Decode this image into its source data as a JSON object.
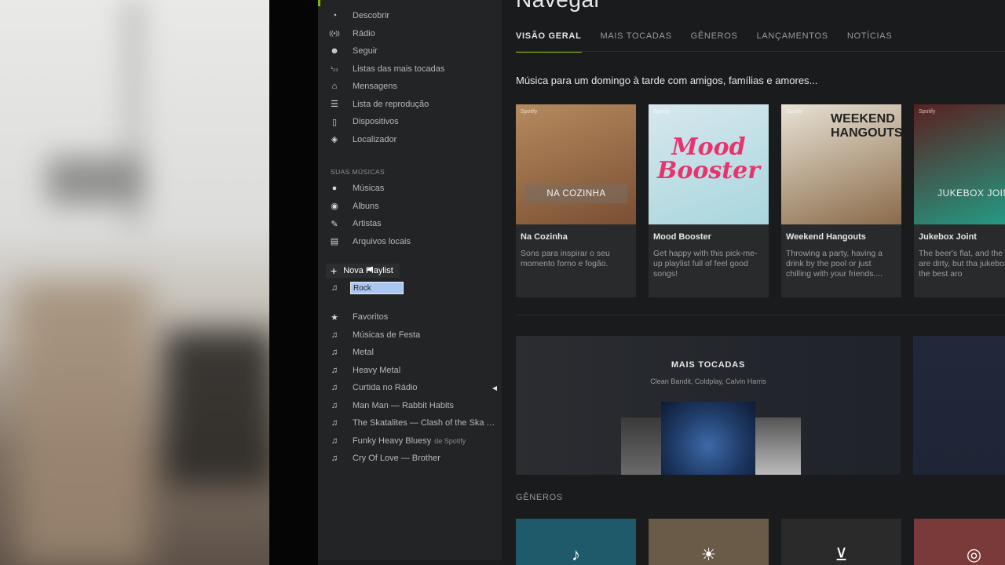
{
  "header": {
    "title": "Navegar"
  },
  "tabs": [
    {
      "label": "VISÃO GERAL",
      "active": true
    },
    {
      "label": "MAIS TOCADAS"
    },
    {
      "label": "GÊNEROS"
    },
    {
      "label": "LANÇAMENTOS"
    },
    {
      "label": "NOTÍCIAS"
    }
  ],
  "sidebar": {
    "nav": [
      {
        "label": "Descobrir",
        "icon": "compass-icon"
      },
      {
        "label": "Rádio",
        "icon": "radio-icon"
      },
      {
        "label": "Seguir",
        "icon": "follow-icon"
      },
      {
        "label": "Listas das mais tocadas",
        "icon": "charts-icon"
      },
      {
        "label": "Mensagens",
        "icon": "inbox-icon"
      },
      {
        "label": "Lista de reprodução",
        "icon": "queue-icon"
      },
      {
        "label": "Dispositivos",
        "icon": "devices-icon"
      },
      {
        "label": "Localizador",
        "icon": "cube-icon"
      }
    ],
    "your_music_title": "SUAS MÚSICAS",
    "your_music": [
      {
        "label": "Músicas",
        "icon": "songs-icon"
      },
      {
        "label": "Álbuns",
        "icon": "albums-icon"
      },
      {
        "label": "Artistas",
        "icon": "artists-icon"
      },
      {
        "label": "Arquivos locais",
        "icon": "local-files-icon"
      }
    ],
    "new_playlist": "Nova Playlist",
    "rename_value": "Rock",
    "playlists": [
      {
        "label": "Favoritos",
        "icon": "star-icon"
      },
      {
        "label": "Músicas de Festa",
        "icon": "note-icon"
      },
      {
        "label": "Metal",
        "icon": "note-icon"
      },
      {
        "label": "Heavy Metal",
        "icon": "note-icon"
      },
      {
        "label": "Curtida no Rádio",
        "icon": "note-icon",
        "playing": true
      },
      {
        "label": "Man Man — Rabbit Habits",
        "icon": "note-icon"
      },
      {
        "label": "The Skatalites — Clash of the Ska Ti...",
        "icon": "note-icon"
      },
      {
        "label": "Funky Heavy Bluesy",
        "by": "de Spotify",
        "icon": "note-icon"
      },
      {
        "label": "Cry Of Love — Brother",
        "icon": "note-icon"
      }
    ]
  },
  "main": {
    "headline": "Música para um domingo à tarde com amigos, famílias e amores...",
    "cards": [
      {
        "name": "Na Cozinha",
        "overlay": "NA COZINHA",
        "desc": "Sons para inspirar o seu momento forno e fogão.",
        "colors": [
          "#b58a5e",
          "#7a4f33"
        ]
      },
      {
        "name": "Mood Booster",
        "overlay": "Mood Booster",
        "desc": "Get happy with this pick-me-up playlist full of feel good songs!",
        "colors": [
          "#d7e7ee",
          "#a8d6dd"
        ]
      },
      {
        "name": "Weekend Hangouts",
        "overlay": "WEEKEND HANGOUTS",
        "desc": "Throwing a party, having a drink by the pool or just chilling with your friends....",
        "colors": [
          "#e8e2d4",
          "#8a6b4a"
        ]
      },
      {
        "name": "Jukebox Joint",
        "overlay": "JUKEBOX JOIN",
        "desc": "The beer's flat, and the floors are dirty, but tha jukebox is the best aro",
        "colors": [
          "#5a2020",
          "#20a28a"
        ]
      }
    ],
    "spotify_tag": "Spotify",
    "feature": {
      "title": "MAIS TOCADAS",
      "subtitle": "Clean Bandit, Coldplay, Calvin Harris"
    },
    "genres_title": "GÊNEROS",
    "genres": [
      {
        "icon": "guitar-icon",
        "color": "#1e5a6a"
      },
      {
        "icon": "sun-icon",
        "color": "#6a5a48"
      },
      {
        "icon": "drinks-icon",
        "color": "#2a2a2a"
      },
      {
        "icon": "microphone-icon",
        "color": "#7a3a3a"
      }
    ]
  }
}
